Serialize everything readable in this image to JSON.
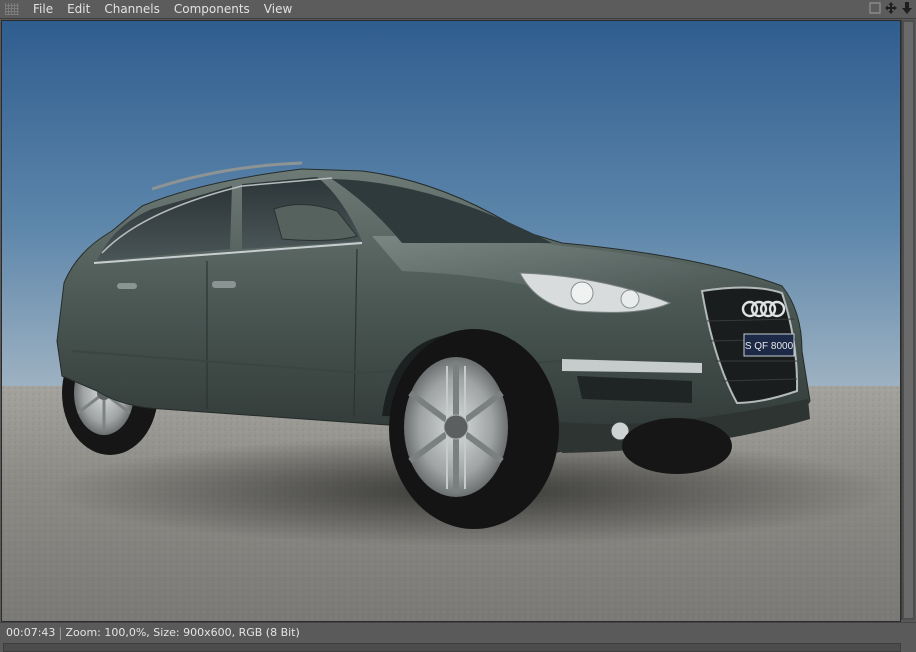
{
  "menu": {
    "items": [
      "File",
      "Edit",
      "Channels",
      "Components",
      "View"
    ]
  },
  "window_icons": [
    "fit-view-icon",
    "move-icon",
    "download-arrow-icon"
  ],
  "status": {
    "time": "00:07:43",
    "details": "Zoom: 100,0%, Size: 900x600, RGB (8 Bit)"
  },
  "render": {
    "license_plate": "S QF 8000"
  },
  "colors": {
    "sky_top": "#2f5f8f",
    "sky_bottom": "#8ea8bd",
    "ground": "#8d8c88",
    "car_body": "#4b5753"
  }
}
